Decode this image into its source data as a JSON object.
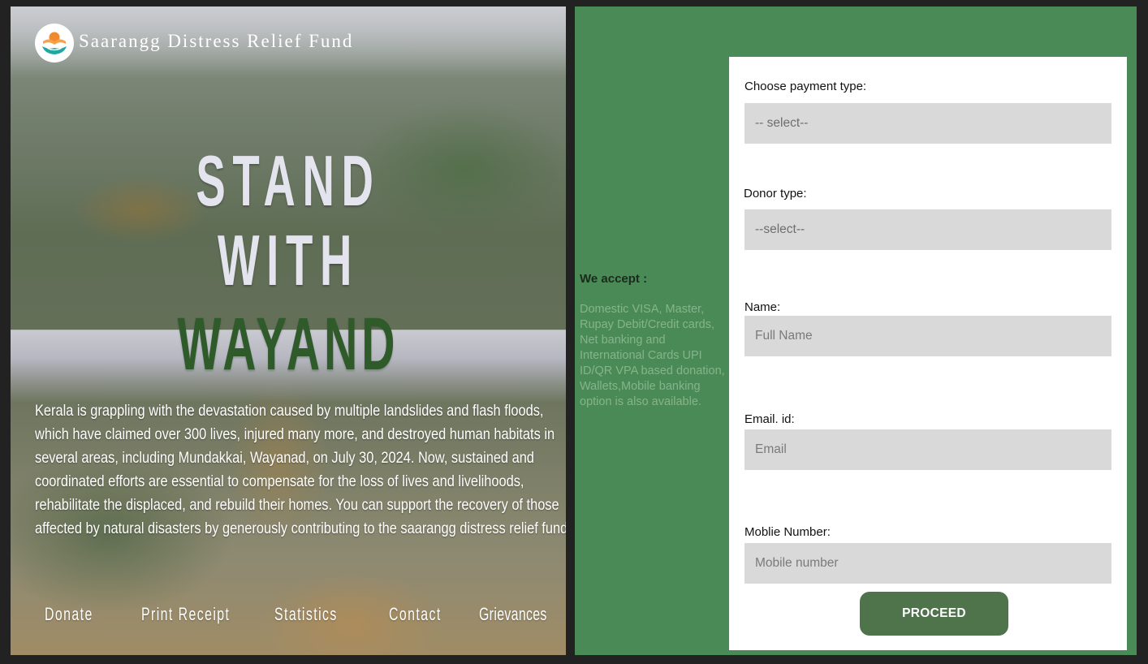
{
  "brand": {
    "name": "Saarangg Distress Relief Fund",
    "logo_icon": "helping-hands-icon"
  },
  "hero": {
    "headline_line1": "STAND",
    "headline_line2": "WITH",
    "headline_line3": "WAYAND",
    "body": "Kerala is grappling with the devastation caused by multiple landslides and flash floods, which have claimed over 300 lives, injured many more, and destroyed human habitats in several areas, including Mundakkai, Wayanad, on July 30, 2024. Now, sustained and coordinated efforts are essential to compensate for the loss of lives and livelihoods, rehabilitate the displaced, and rebuild their homes. You can support the recovery of those affected by natural disasters by generously contributing to the saarangg distress relief fund"
  },
  "nav": {
    "items": [
      "Donate",
      "Print Receipt",
      "Statistics",
      "Contact",
      "Grievances"
    ]
  },
  "payment_info": {
    "title": "We accept :",
    "text": "Domestic VISA, Master, Rupay Debit/Credit cards, Net banking and International Cards UPI ID/QR VPA based donation, Wallets,Mobile banking option is also available."
  },
  "form": {
    "payment_type_label": "Choose payment type:",
    "payment_type_value": "-- select--",
    "donor_type_label": "Donor type:",
    "donor_type_value": "--select--",
    "name_label": "Name:",
    "name_placeholder": "Full Name",
    "email_label": "Email. id:",
    "email_placeholder": "Email",
    "mobile_label": "Moblie Number:",
    "mobile_placeholder": "Mobile number",
    "proceed_label": "PROCEED"
  },
  "colors": {
    "panel_green": "#4a8a57",
    "button_green": "#4f734b",
    "headline_green": "#2f5a2a",
    "field_gray": "#d9d9d9"
  }
}
